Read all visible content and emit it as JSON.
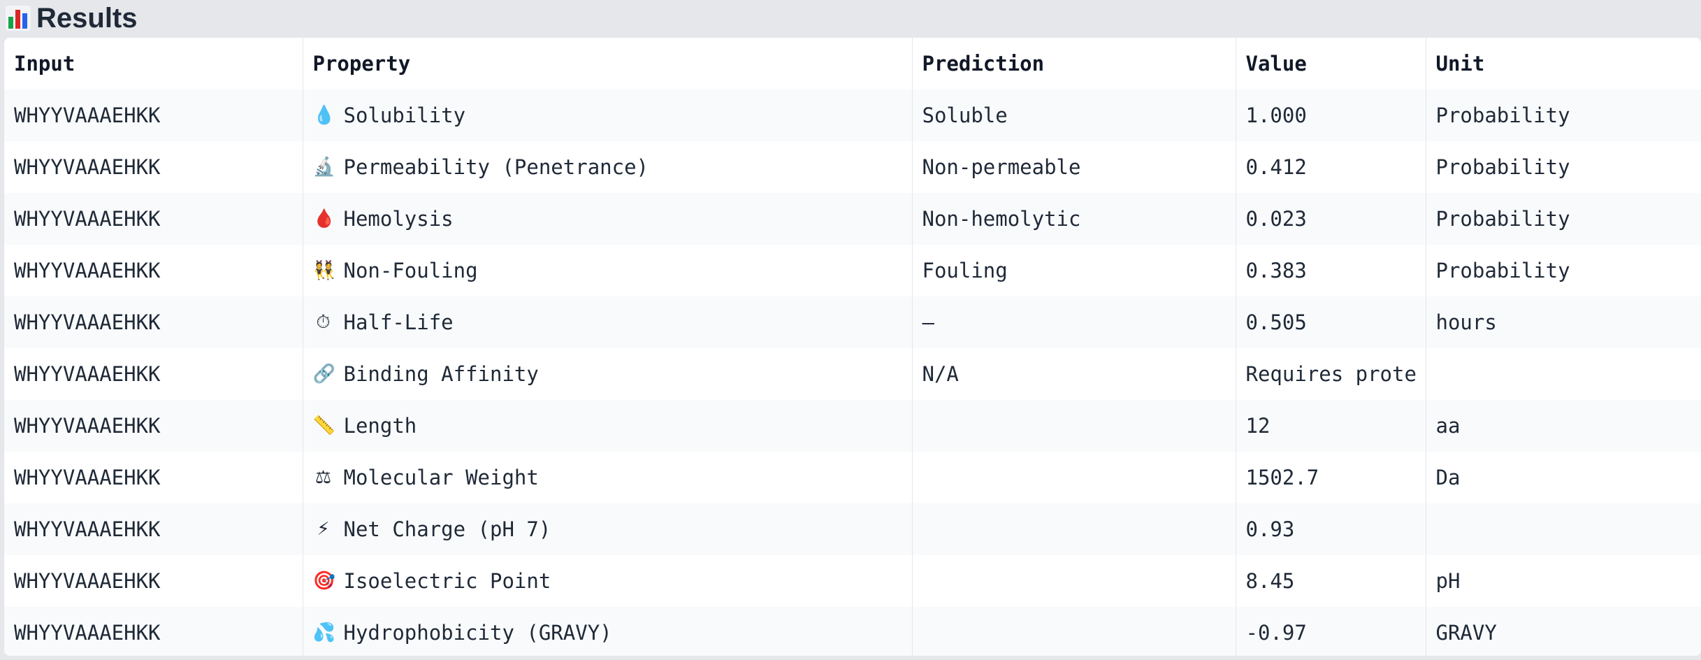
{
  "header": {
    "title": "Results",
    "icon": "bar-chart-icon"
  },
  "table": {
    "columns": [
      "Input",
      "Property",
      "Prediction",
      "Value",
      "Unit"
    ],
    "rows": [
      {
        "input": "WHYYVAAAEHKK",
        "icon": "💧",
        "icon_name": "droplet-icon",
        "property": "Solubility",
        "prediction": "Soluble",
        "value": "1.000",
        "unit": "Probability"
      },
      {
        "input": "WHYYVAAAEHKK",
        "icon": "🔬",
        "icon_name": "microscope-icon",
        "property": "Permeability (Penetrance)",
        "prediction": "Non-permeable",
        "value": "0.412",
        "unit": "Probability"
      },
      {
        "input": "WHYYVAAAEHKK",
        "icon": "🩸",
        "icon_name": "blood-drop-icon",
        "property": "Hemolysis",
        "prediction": "Non-hemolytic",
        "value": "0.023",
        "unit": "Probability"
      },
      {
        "input": "WHYYVAAAEHKK",
        "icon": "👯",
        "icon_name": "people-icon",
        "property": "Non-Fouling",
        "prediction": "Fouling",
        "value": "0.383",
        "unit": "Probability"
      },
      {
        "input": "WHYYVAAAEHKK",
        "icon": "⏱",
        "icon_name": "stopwatch-icon",
        "property": "Half-Life",
        "prediction": "—",
        "value": "0.505",
        "unit": "hours"
      },
      {
        "input": "WHYYVAAAEHKK",
        "icon": "🔗",
        "icon_name": "link-icon",
        "property": "Binding Affinity",
        "prediction": "N/A",
        "value": "Requires prote",
        "unit": ""
      },
      {
        "input": "WHYYVAAAEHKK",
        "icon": "📏",
        "icon_name": "ruler-icon",
        "property": "Length",
        "prediction": "",
        "value": "12",
        "unit": "aa"
      },
      {
        "input": "WHYYVAAAEHKK",
        "icon": "⚖",
        "icon_name": "balance-scale-icon",
        "property": "Molecular Weight",
        "prediction": "",
        "value": "1502.7",
        "unit": "Da"
      },
      {
        "input": "WHYYVAAAEHKK",
        "icon": "⚡",
        "icon_name": "lightning-icon",
        "property": "Net Charge (pH 7)",
        "prediction": "",
        "value": "0.93",
        "unit": ""
      },
      {
        "input": "WHYYVAAAEHKK",
        "icon": "🎯",
        "icon_name": "target-icon",
        "property": "Isoelectric Point",
        "prediction": "",
        "value": "8.45",
        "unit": "pH"
      },
      {
        "input": "WHYYVAAAEHKK",
        "icon": "💦",
        "icon_name": "water-splash-icon",
        "property": "Hydrophobicity (GRAVY)",
        "prediction": "",
        "value": "-0.97",
        "unit": "GRAVY"
      }
    ]
  },
  "colors": {
    "background": "#e5e7eb",
    "table_bg": "#ffffff",
    "stripe": "#f9fafb",
    "text": "#1f2937",
    "icon_bar_green": "#16a34a",
    "icon_bar_red": "#dc2626",
    "icon_bar_blue": "#2563eb"
  }
}
